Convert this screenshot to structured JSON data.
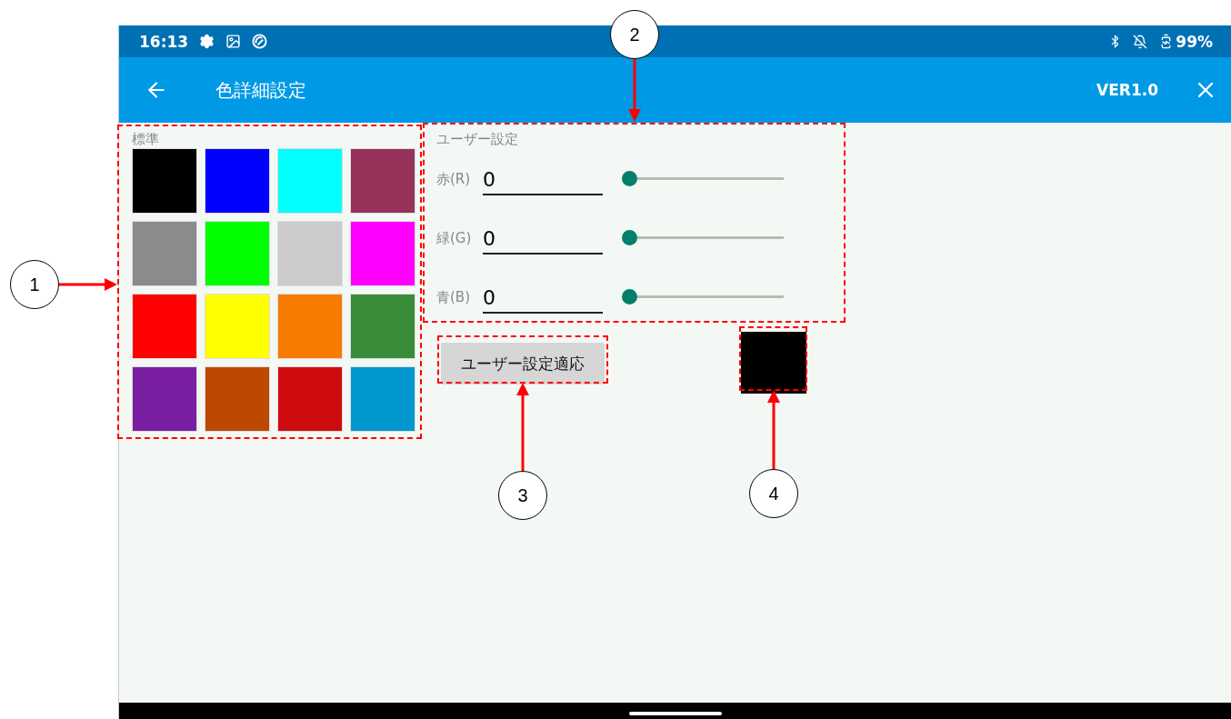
{
  "status_bar": {
    "time": "16:13",
    "battery": "99%"
  },
  "app_bar": {
    "title": "色詳細設定",
    "version": "VER1.0"
  },
  "standard": {
    "label": "標準",
    "swatches": [
      {
        "color": "#000000"
      },
      {
        "color": "#0000ff"
      },
      {
        "color": "#00ffff"
      },
      {
        "color": "#94325a"
      },
      {
        "color": "#8c8a8c"
      },
      {
        "color": "#00ff00"
      },
      {
        "color": "#cccacc"
      },
      {
        "color": "#ff00ff"
      },
      {
        "color": "#ff0000"
      },
      {
        "color": "#ffff00"
      },
      {
        "color": "#f77b00"
      },
      {
        "color": "#398c3a"
      },
      {
        "color": "#7b1fa2"
      },
      {
        "color": "#bd4800"
      },
      {
        "color": "#ce0c10"
      },
      {
        "color": "#0098ce"
      }
    ]
  },
  "user_settings": {
    "label": "ユーザー設定",
    "channels": [
      {
        "label": "赤(R)",
        "value": "0",
        "level": 0
      },
      {
        "label": "緑(G)",
        "value": "0",
        "level": 0
      },
      {
        "label": "青(B)",
        "value": "0",
        "level": 0
      }
    ]
  },
  "apply_button": "ユーザー設定適応",
  "preview": {
    "color": "#000000"
  },
  "annotations": [
    {
      "label": "1"
    },
    {
      "label": "2"
    },
    {
      "label": "3"
    },
    {
      "label": "4"
    }
  ]
}
